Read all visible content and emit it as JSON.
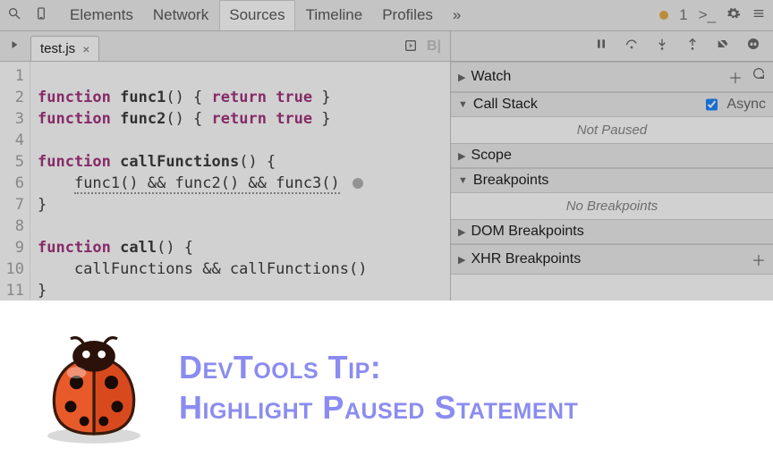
{
  "toolbar": {
    "tabs": [
      "Elements",
      "Network",
      "Sources",
      "Timeline",
      "Profiles"
    ],
    "active_tab_index": 2,
    "overflow_glyph": "»",
    "warning_count": "1",
    "console_glyph": ">_"
  },
  "file_tab": {
    "name": "test.js",
    "close_glyph": "×"
  },
  "code": {
    "lines": [
      {
        "n": "1",
        "html": ""
      },
      {
        "n": "2",
        "html": "<span class='kw'>function</span> <span class='fn'>func1</span>() { <span class='kw'>return</span> <span class='lit'>true</span> }"
      },
      {
        "n": "3",
        "html": "<span class='kw'>function</span> <span class='fn'>func2</span>() { <span class='kw'>return</span> <span class='lit'>true</span> }"
      },
      {
        "n": "4",
        "html": ""
      },
      {
        "n": "5",
        "html": "<span class='kw'>function</span> <span class='fn'>callFunctions</span>() {"
      },
      {
        "n": "6",
        "html": "    <span class='squiggle'>func1() && func2() && func3()</span> <span class='bp-dot'></span>"
      },
      {
        "n": "7",
        "html": "}"
      },
      {
        "n": "8",
        "html": ""
      },
      {
        "n": "9",
        "html": "<span class='kw'>function</span> <span class='fn'>call</span>() {"
      },
      {
        "n": "10",
        "html": "    callFunctions && callFunctions()"
      },
      {
        "n": "11",
        "html": "}"
      }
    ]
  },
  "debugger": {
    "sections": {
      "watch": {
        "label": "Watch",
        "expanded": false
      },
      "call_stack": {
        "label": "Call Stack",
        "expanded": true,
        "async_label": "Async",
        "async_checked": true,
        "status": "Not Paused"
      },
      "scope": {
        "label": "Scope",
        "expanded": false
      },
      "breakpoints": {
        "label": "Breakpoints",
        "expanded": true,
        "status": "No Breakpoints"
      },
      "dom_bp": {
        "label": "DOM Breakpoints",
        "expanded": false
      },
      "xhr_bp": {
        "label": "XHR Breakpoints",
        "expanded": false
      }
    }
  },
  "tip": {
    "line1": "DevTools Tip:",
    "line2": "Highlight Paused Statement"
  }
}
